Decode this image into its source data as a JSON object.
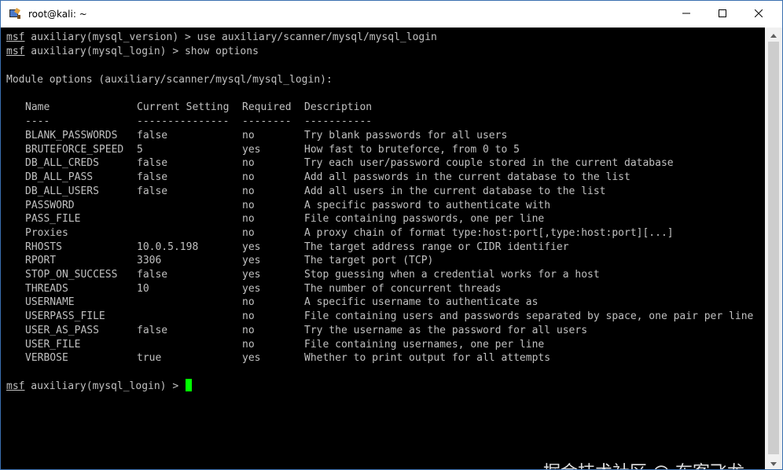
{
  "window": {
    "title": "root@kali: ~",
    "icon": "terminal-app-icon",
    "controls": {
      "minimize_icon": "minimize-icon",
      "maximize_icon": "maximize-icon",
      "close_icon": "close-icon"
    }
  },
  "terminal": {
    "prompt_word": "msf",
    "lines": [
      {
        "prompt_rest": " auxiliary(mysql_version) > use auxiliary/scanner/mysql/mysql_login"
      },
      {
        "prompt_rest": " auxiliary(mysql_login) > show options"
      }
    ],
    "module_options_heading": "Module options (auxiliary/scanner/mysql/mysql_login):",
    "table": {
      "headers": [
        "Name",
        "Current Setting",
        "Required",
        "Description"
      ],
      "underlines": [
        "----",
        "---------------",
        "--------",
        "-----------"
      ],
      "rows": [
        [
          "BLANK_PASSWORDS",
          "false",
          "no",
          "Try blank passwords for all users"
        ],
        [
          "BRUTEFORCE_SPEED",
          "5",
          "yes",
          "How fast to bruteforce, from 0 to 5"
        ],
        [
          "DB_ALL_CREDS",
          "false",
          "no",
          "Try each user/password couple stored in the current database"
        ],
        [
          "DB_ALL_PASS",
          "false",
          "no",
          "Add all passwords in the current database to the list"
        ],
        [
          "DB_ALL_USERS",
          "false",
          "no",
          "Add all users in the current database to the list"
        ],
        [
          "PASSWORD",
          "",
          "no",
          "A specific password to authenticate with"
        ],
        [
          "PASS_FILE",
          "",
          "no",
          "File containing passwords, one per line"
        ],
        [
          "Proxies",
          "",
          "no",
          "A proxy chain of format type:host:port[,type:host:port][...]"
        ],
        [
          "RHOSTS",
          "10.0.5.198",
          "yes",
          "The target address range or CIDR identifier"
        ],
        [
          "RPORT",
          "3306",
          "yes",
          "The target port (TCP)"
        ],
        [
          "STOP_ON_SUCCESS",
          "false",
          "yes",
          "Stop guessing when a credential works for a host"
        ],
        [
          "THREADS",
          "10",
          "yes",
          "The number of concurrent threads"
        ],
        [
          "USERNAME",
          "",
          "no",
          "A specific username to authenticate as"
        ],
        [
          "USERPASS_FILE",
          "",
          "no",
          "File containing users and passwords separated by space, one pair per line"
        ],
        [
          "USER_AS_PASS",
          "false",
          "no",
          "Try the username as the password for all users"
        ],
        [
          "USER_FILE",
          "",
          "no",
          "File containing usernames, one per line"
        ],
        [
          "VERBOSE",
          "true",
          "yes",
          "Whether to print output for all attempts"
        ]
      ]
    },
    "current_prompt_rest": " auxiliary(mysql_login) > ",
    "cursor_color": "#00ff00"
  },
  "watermark": "掘金技术社区 @ 布客飞龙",
  "colors": {
    "terminal_bg": "#000000",
    "terminal_fg": "#c0c0c0",
    "titlebar_bg": "#ffffff",
    "cursor": "#00ff00"
  },
  "scrollbar": {
    "up_icon": "scroll-up-arrow-icon",
    "down_icon": "scroll-down-arrow-icon"
  }
}
